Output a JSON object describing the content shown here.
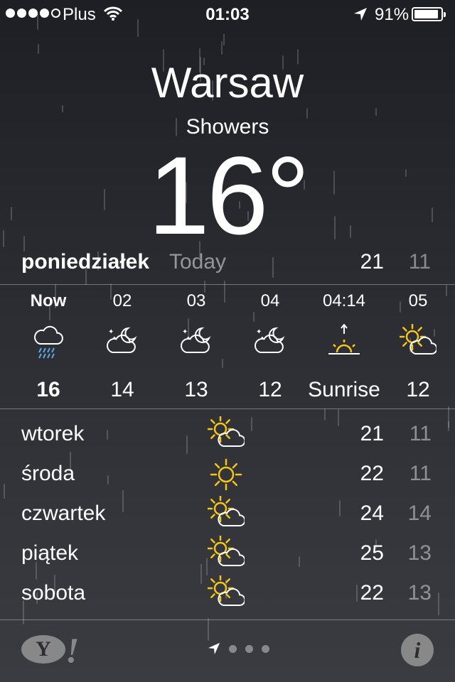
{
  "status_bar": {
    "signal_bars_filled": 4,
    "signal_bars_total": 5,
    "carrier": "Plus",
    "time": "01:03",
    "battery_pct": "91%",
    "battery_level": 0.91
  },
  "weather": {
    "city": "Warsaw",
    "condition": "Showers",
    "temperature": "16°"
  },
  "today_row": {
    "day": "poniedziałek",
    "label": "Today",
    "high": "21",
    "low": "11"
  },
  "hourly": [
    {
      "label": "Now",
      "icon": "rain-cloud-icon",
      "value": "16",
      "bold": true
    },
    {
      "label": "02",
      "icon": "night-partly-cloudy-icon",
      "value": "14",
      "bold": false
    },
    {
      "label": "03",
      "icon": "night-partly-cloudy-icon",
      "value": "13",
      "bold": false
    },
    {
      "label": "04",
      "icon": "night-partly-cloudy-icon",
      "value": "12",
      "bold": false
    },
    {
      "label": "04:14",
      "icon": "sunrise-icon",
      "value": "Sunrise",
      "bold": false
    },
    {
      "label": "05",
      "icon": "partly-sunny-icon",
      "value": "12",
      "bold": false
    }
  ],
  "daily": [
    {
      "day": "wtorek",
      "icon": "partly-sunny-icon",
      "high": "21",
      "low": "11"
    },
    {
      "day": "środa",
      "icon": "sunny-icon",
      "high": "22",
      "low": "11"
    },
    {
      "day": "czwartek",
      "icon": "partly-sunny-icon",
      "high": "24",
      "low": "14"
    },
    {
      "day": "piątek",
      "icon": "partly-sunny-icon",
      "high": "25",
      "low": "13"
    },
    {
      "day": "sobota",
      "icon": "partly-sunny-icon",
      "high": "22",
      "low": "13"
    }
  ],
  "footer": {
    "yahoo_logo_text": "Y!",
    "page_count": 4,
    "current_page": 0,
    "info_glyph": "i"
  },
  "colors": {
    "sun": "#f5c518",
    "rain": "#5aa9e6",
    "dim_text": "rgba(255,255,255,0.45)"
  }
}
